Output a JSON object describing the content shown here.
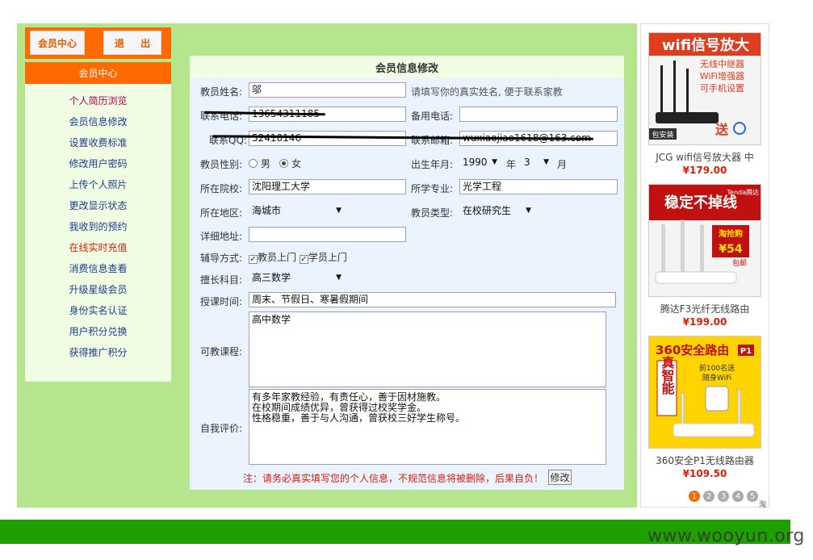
{
  "colors": {
    "green_bg": "#b5e58c",
    "orange": "#ff6a00",
    "footer_green": "#1f9f00",
    "price_red": "#d81e06"
  },
  "top_buttons": {
    "member_center": "会员中心",
    "logout": "退 出"
  },
  "menu": {
    "header": "会员中心",
    "items": [
      "个人简历浏览",
      "会员信息修改",
      "设置收费标准",
      "修改用户密码",
      "上传个人照片",
      "更改显示状态",
      "我收到的预约",
      "在线实时充值",
      "消费信息查看",
      "升级星级会员",
      "身份实名认证",
      "用户积分兑换",
      "获得推广积分"
    ]
  },
  "form": {
    "title": "会员信息修改",
    "name_label": "教员姓名:",
    "name_value": "邬",
    "name_hint": "请填写你的真实姓名, 便于联系家教",
    "phone_label": "联系电话:",
    "phone_value": "13654311185",
    "phone2_label": "备用电话:",
    "phone2_value": "",
    "qq_label": "联系QQ:",
    "qq_value": "52410146",
    "email_label": "联系邮箱:",
    "email_value": "wuxiaojiao1618@163.com",
    "gender_label": "教员性别:",
    "gender_male": "男",
    "gender_female": "女",
    "birth_label": "出生年月:",
    "birth_year": "1990",
    "birth_year_unit": "年",
    "birth_month": "3",
    "birth_month_unit": "月",
    "school_label": "所在院校:",
    "school_value": "沈阳理工大学",
    "major_label": "所学专业:",
    "major_value": "光学工程",
    "area_label": "所在地区:",
    "area_value": "海城市",
    "type_label": "教员类型:",
    "type_value": "在校研究生",
    "address_label": "详细地址:",
    "address_value": "",
    "mode_label": "辅导方式:",
    "mode_teacher": "教员上门",
    "mode_student": "学员上门",
    "subject_label": "擅长科目:",
    "subject_value": "高三数学",
    "time_label": "授课时间:",
    "time_value": "周末、节假日、寒暑假期间",
    "courses_label": "可教课程:",
    "courses_value": "高中数学",
    "self_label": "自我评价:",
    "self_value": "有多年家教经验，有责任心，善于因材施教。\n在校期间成绩优异，曾获得过校奖学金。\n性格稳重，善于与人沟通，曾获校三好学生称号。",
    "note": "注：请务必真实填写您的个人信息，不规范信息将被删除，后果自负！",
    "submit": "修改"
  },
  "ads": [
    {
      "name": "JCG wifi信号放大器 中",
      "price": "¥179.00",
      "img_text": [
        "wifi信号放大",
        "无线中继器",
        "WiFi增强器",
        "可手机设置",
        "包安装",
        "送"
      ]
    },
    {
      "name": "腾达F3光纤无线路由",
      "price": "¥199.00",
      "img_text": [
        "稳定不掉线",
        "Tenda腾达",
        "淘抢购",
        "¥54",
        "包邮"
      ]
    },
    {
      "name": "360安全P1无线路由器",
      "price": "¥109.50",
      "img_text": [
        "360安全路由",
        "P1",
        "真智能",
        "前100名送",
        "随身WiFi"
      ]
    }
  ],
  "pager": {
    "pages": [
      "1",
      "2",
      "3",
      "4",
      "5"
    ],
    "current": "1",
    "tao": "淘"
  },
  "watermark": "www.wooyun.org"
}
